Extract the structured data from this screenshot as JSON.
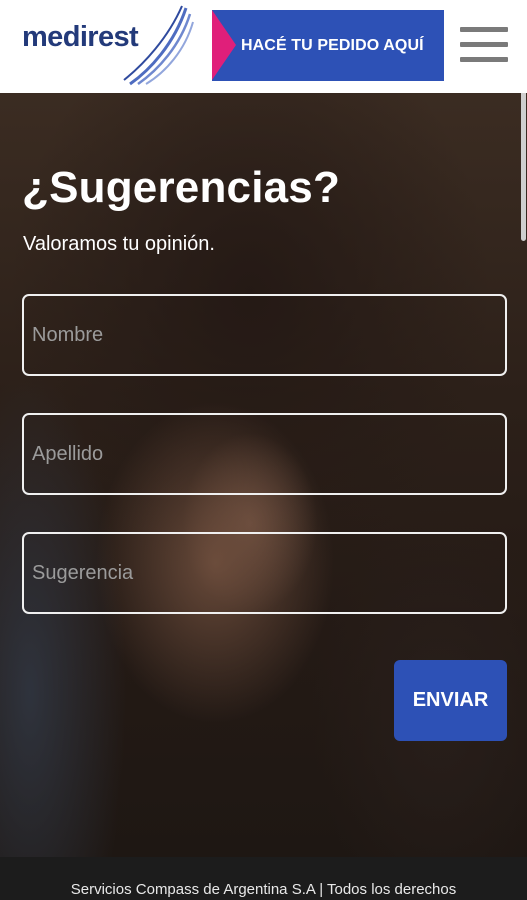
{
  "header": {
    "logo_text": "medirest",
    "order_button_label": "HACÉ TU PEDIDO AQUÍ",
    "menu_icon": "hamburger-menu-icon"
  },
  "form": {
    "title": "¿Sugerencias?",
    "subtitle": "Valoramos tu opinión.",
    "first_name_placeholder": "Nombre",
    "last_name_placeholder": "Apellido",
    "suggestion_placeholder": "Sugerencia",
    "submit_label": "ENVIAR"
  },
  "footer": {
    "text": "Servicios Compass de Argentina S.A | Todos los derechos"
  },
  "colors": {
    "brand_blue": "#2d51b6",
    "accent_pink": "#e01f7a",
    "logo_navy": "#233a7a"
  }
}
